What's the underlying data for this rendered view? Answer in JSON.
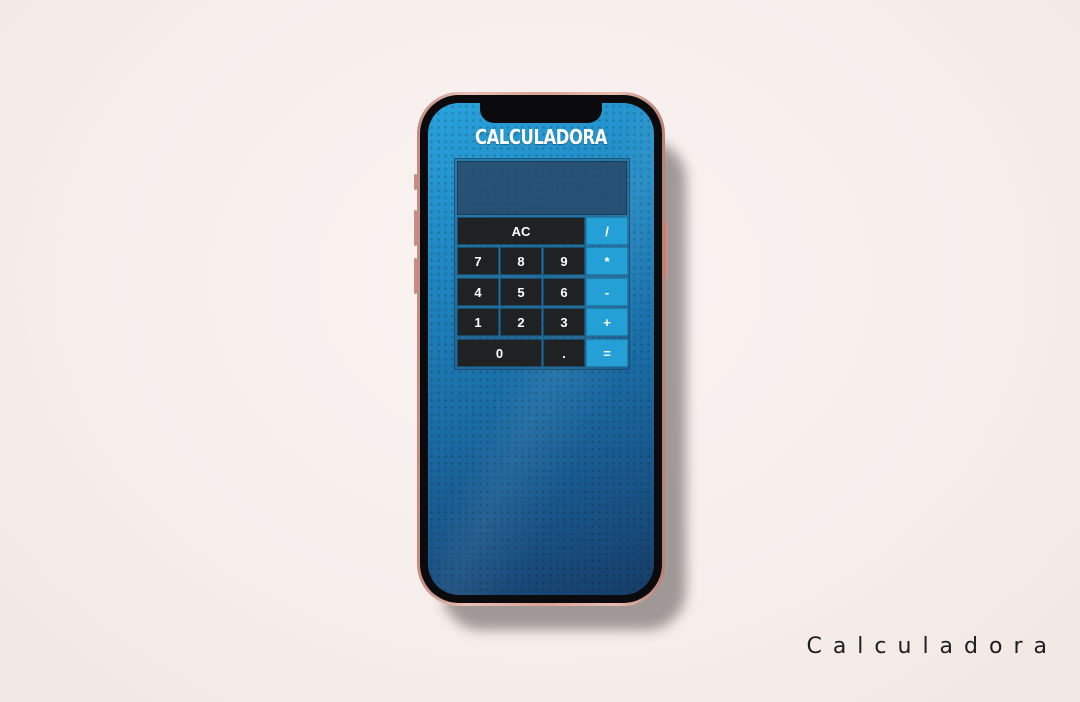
{
  "app": {
    "title": "CALCULADORA"
  },
  "display": {
    "value": ""
  },
  "keys": {
    "clear": "AC",
    "divide": "/",
    "multiply": "*",
    "subtract": "-",
    "add": "+",
    "equals": "=",
    "seven": "7",
    "eight": "8",
    "nine": "9",
    "four": "4",
    "five": "5",
    "six": "6",
    "one": "1",
    "two": "2",
    "three": "3",
    "zero": "0",
    "decimal": "."
  },
  "caption": "Calculadora",
  "colors": {
    "operator_key": "#25a0d6",
    "number_key": "#202123",
    "screen_top": "#2aa3dc",
    "screen_bottom": "#163d66",
    "phone_frame": "#d9a394",
    "background": "#f6eeeb"
  }
}
